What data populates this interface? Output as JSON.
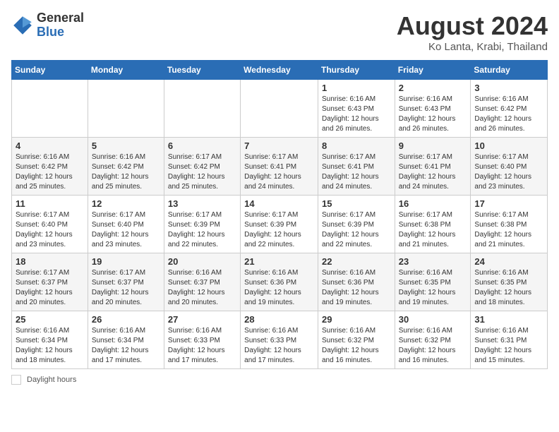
{
  "header": {
    "logo_general": "General",
    "logo_blue": "Blue",
    "title": "August 2024",
    "subtitle": "Ko Lanta, Krabi, Thailand"
  },
  "days_of_week": [
    "Sunday",
    "Monday",
    "Tuesday",
    "Wednesday",
    "Thursday",
    "Friday",
    "Saturday"
  ],
  "legend": {
    "text": "Daylight hours"
  },
  "weeks": [
    [
      {
        "day": "",
        "info": ""
      },
      {
        "day": "",
        "info": ""
      },
      {
        "day": "",
        "info": ""
      },
      {
        "day": "",
        "info": ""
      },
      {
        "day": "1",
        "info": "Sunrise: 6:16 AM\nSunset: 6:43 PM\nDaylight: 12 hours\nand 26 minutes."
      },
      {
        "day": "2",
        "info": "Sunrise: 6:16 AM\nSunset: 6:43 PM\nDaylight: 12 hours\nand 26 minutes."
      },
      {
        "day": "3",
        "info": "Sunrise: 6:16 AM\nSunset: 6:42 PM\nDaylight: 12 hours\nand 26 minutes."
      }
    ],
    [
      {
        "day": "4",
        "info": "Sunrise: 6:16 AM\nSunset: 6:42 PM\nDaylight: 12 hours\nand 25 minutes."
      },
      {
        "day": "5",
        "info": "Sunrise: 6:16 AM\nSunset: 6:42 PM\nDaylight: 12 hours\nand 25 minutes."
      },
      {
        "day": "6",
        "info": "Sunrise: 6:17 AM\nSunset: 6:42 PM\nDaylight: 12 hours\nand 25 minutes."
      },
      {
        "day": "7",
        "info": "Sunrise: 6:17 AM\nSunset: 6:41 PM\nDaylight: 12 hours\nand 24 minutes."
      },
      {
        "day": "8",
        "info": "Sunrise: 6:17 AM\nSunset: 6:41 PM\nDaylight: 12 hours\nand 24 minutes."
      },
      {
        "day": "9",
        "info": "Sunrise: 6:17 AM\nSunset: 6:41 PM\nDaylight: 12 hours\nand 24 minutes."
      },
      {
        "day": "10",
        "info": "Sunrise: 6:17 AM\nSunset: 6:40 PM\nDaylight: 12 hours\nand 23 minutes."
      }
    ],
    [
      {
        "day": "11",
        "info": "Sunrise: 6:17 AM\nSunset: 6:40 PM\nDaylight: 12 hours\nand 23 minutes."
      },
      {
        "day": "12",
        "info": "Sunrise: 6:17 AM\nSunset: 6:40 PM\nDaylight: 12 hours\nand 23 minutes."
      },
      {
        "day": "13",
        "info": "Sunrise: 6:17 AM\nSunset: 6:39 PM\nDaylight: 12 hours\nand 22 minutes."
      },
      {
        "day": "14",
        "info": "Sunrise: 6:17 AM\nSunset: 6:39 PM\nDaylight: 12 hours\nand 22 minutes."
      },
      {
        "day": "15",
        "info": "Sunrise: 6:17 AM\nSunset: 6:39 PM\nDaylight: 12 hours\nand 22 minutes."
      },
      {
        "day": "16",
        "info": "Sunrise: 6:17 AM\nSunset: 6:38 PM\nDaylight: 12 hours\nand 21 minutes."
      },
      {
        "day": "17",
        "info": "Sunrise: 6:17 AM\nSunset: 6:38 PM\nDaylight: 12 hours\nand 21 minutes."
      }
    ],
    [
      {
        "day": "18",
        "info": "Sunrise: 6:17 AM\nSunset: 6:37 PM\nDaylight: 12 hours\nand 20 minutes."
      },
      {
        "day": "19",
        "info": "Sunrise: 6:17 AM\nSunset: 6:37 PM\nDaylight: 12 hours\nand 20 minutes."
      },
      {
        "day": "20",
        "info": "Sunrise: 6:16 AM\nSunset: 6:37 PM\nDaylight: 12 hours\nand 20 minutes."
      },
      {
        "day": "21",
        "info": "Sunrise: 6:16 AM\nSunset: 6:36 PM\nDaylight: 12 hours\nand 19 minutes."
      },
      {
        "day": "22",
        "info": "Sunrise: 6:16 AM\nSunset: 6:36 PM\nDaylight: 12 hours\nand 19 minutes."
      },
      {
        "day": "23",
        "info": "Sunrise: 6:16 AM\nSunset: 6:35 PM\nDaylight: 12 hours\nand 19 minutes."
      },
      {
        "day": "24",
        "info": "Sunrise: 6:16 AM\nSunset: 6:35 PM\nDaylight: 12 hours\nand 18 minutes."
      }
    ],
    [
      {
        "day": "25",
        "info": "Sunrise: 6:16 AM\nSunset: 6:34 PM\nDaylight: 12 hours\nand 18 minutes."
      },
      {
        "day": "26",
        "info": "Sunrise: 6:16 AM\nSunset: 6:34 PM\nDaylight: 12 hours\nand 17 minutes."
      },
      {
        "day": "27",
        "info": "Sunrise: 6:16 AM\nSunset: 6:33 PM\nDaylight: 12 hours\nand 17 minutes."
      },
      {
        "day": "28",
        "info": "Sunrise: 6:16 AM\nSunset: 6:33 PM\nDaylight: 12 hours\nand 17 minutes."
      },
      {
        "day": "29",
        "info": "Sunrise: 6:16 AM\nSunset: 6:32 PM\nDaylight: 12 hours\nand 16 minutes."
      },
      {
        "day": "30",
        "info": "Sunrise: 6:16 AM\nSunset: 6:32 PM\nDaylight: 12 hours\nand 16 minutes."
      },
      {
        "day": "31",
        "info": "Sunrise: 6:16 AM\nSunset: 6:31 PM\nDaylight: 12 hours\nand 15 minutes."
      }
    ]
  ]
}
